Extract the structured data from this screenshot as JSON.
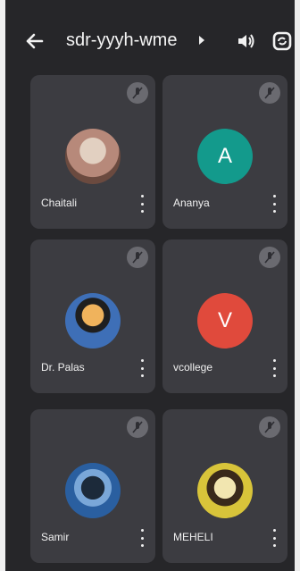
{
  "header": {
    "meeting_code": "sdr-yyyh-wme"
  },
  "participants": [
    {
      "name": "Chaitali",
      "avatar_type": "photo",
      "avatar_colors": [
        "#b7897a",
        "#e2d0c1",
        "#6b4a3f"
      ]
    },
    {
      "name": "Ananya",
      "avatar_type": "initial",
      "initial": "A",
      "avatar_colors": [
        "#139a8c"
      ]
    },
    {
      "name": "Dr. Palas",
      "avatar_type": "photo",
      "avatar_colors": [
        "#3e6fb7",
        "#f0b35c",
        "#1f1f1f"
      ]
    },
    {
      "name": "vcollege",
      "avatar_type": "initial",
      "initial": "V",
      "avatar_colors": [
        "#e04a3c"
      ]
    },
    {
      "name": "Samir",
      "avatar_type": "photo",
      "avatar_colors": [
        "#2a5fa0",
        "#1c2a3a",
        "#7aa7d8"
      ]
    },
    {
      "name": "MEHELI",
      "avatar_type": "photo",
      "avatar_colors": [
        "#d8c43a",
        "#3a2a1a",
        "#f2e6b0"
      ]
    }
  ],
  "icons": {
    "back": "back-arrow-icon",
    "caret": "caret-right-icon",
    "speaker": "speaker-icon",
    "switch_camera": "switch-camera-icon",
    "mic_muted": "mic-off-icon",
    "more": "more-vertical-icon"
  },
  "colors": {
    "background": "#262629",
    "tile": "#3c3c41",
    "mic_badge": "#6a6a70"
  }
}
